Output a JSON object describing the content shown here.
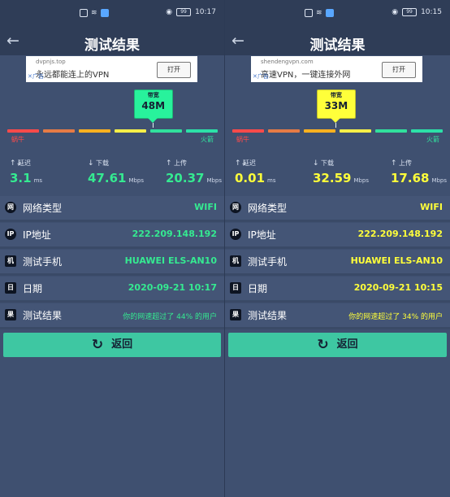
{
  "colors": {
    "left_accent": "#35ea91",
    "right_accent": "#ffff3a",
    "left_band": "#28f29c",
    "right_band": "#ffff3a",
    "scale": [
      "#ff4a4a",
      "#e67b45",
      "#ffb11f",
      "#f6ef48",
      "#31e09d",
      "#2ce1a8"
    ],
    "return_button": "#3ec7a2"
  },
  "screens": [
    {
      "status": {
        "left_icons": "▣ 令 ▣",
        "eye": "◉",
        "battery": "99",
        "time": "10:17"
      },
      "header": {
        "back_icon": "←",
        "title": "测试结果"
      },
      "ad": {
        "domain": "dvpnjs.top",
        "text": "永远都能连上的VPN",
        "button": "打开",
        "tag": "广告"
      },
      "bandwidth": {
        "label": "带宽",
        "value": "48M",
        "level": 0.69
      },
      "scale": {
        "left": "蜗牛",
        "right": "火箭"
      },
      "metrics": [
        {
          "icon": "↑↓",
          "label": "延迟",
          "value": "3.1",
          "unit": "ms"
        },
        {
          "icon": "↓",
          "label": "下载",
          "value": "47.61",
          "unit": "Mbps"
        },
        {
          "icon": "↑",
          "label": "上传",
          "value": "20.37",
          "unit": "Mbps"
        }
      ],
      "info": [
        {
          "icon": "网",
          "label": "网络类型",
          "value": "WIFI"
        },
        {
          "icon": "IP",
          "label": "IP地址",
          "value": "222.209.148.192"
        },
        {
          "icon": "机",
          "label": "测试手机",
          "value": "HUAWEI ELS-AN10"
        },
        {
          "icon": "日",
          "label": "日期",
          "value": "2020-09-21 10:17"
        },
        {
          "icon": "果",
          "label": "测试结果",
          "value": "你的网速超过了 44% 的用户"
        }
      ],
      "return_icon": "↻",
      "return_label": "返回"
    },
    {
      "status": {
        "left_icons": "▣ 令 ▣",
        "eye": "◉",
        "battery": "99",
        "time": "10:15"
      },
      "header": {
        "back_icon": "←",
        "title": "测试结果"
      },
      "ad": {
        "domain": "shendengvpn.com",
        "text": "高速VPN，一键连接外网",
        "button": "打开",
        "tag": "广告"
      },
      "bandwidth": {
        "label": "带宽",
        "value": "33M",
        "level": 0.49
      },
      "scale": {
        "left": "蜗牛",
        "right": "火箭"
      },
      "metrics": [
        {
          "icon": "↑↓",
          "label": "延迟",
          "value": "0.01",
          "unit": "ms"
        },
        {
          "icon": "↓",
          "label": "下载",
          "value": "32.59",
          "unit": "Mbps"
        },
        {
          "icon": "↑",
          "label": "上传",
          "value": "17.68",
          "unit": "Mbps"
        }
      ],
      "info": [
        {
          "icon": "网",
          "label": "网络类型",
          "value": "WIFI"
        },
        {
          "icon": "IP",
          "label": "IP地址",
          "value": "222.209.148.192"
        },
        {
          "icon": "机",
          "label": "测试手机",
          "value": "HUAWEI ELS-AN10"
        },
        {
          "icon": "日",
          "label": "日期",
          "value": "2020-09-21 10:15"
        },
        {
          "icon": "果",
          "label": "测试结果",
          "value": "你的网速超过了 34% 的用户"
        }
      ],
      "return_icon": "↻",
      "return_label": "返回"
    }
  ]
}
